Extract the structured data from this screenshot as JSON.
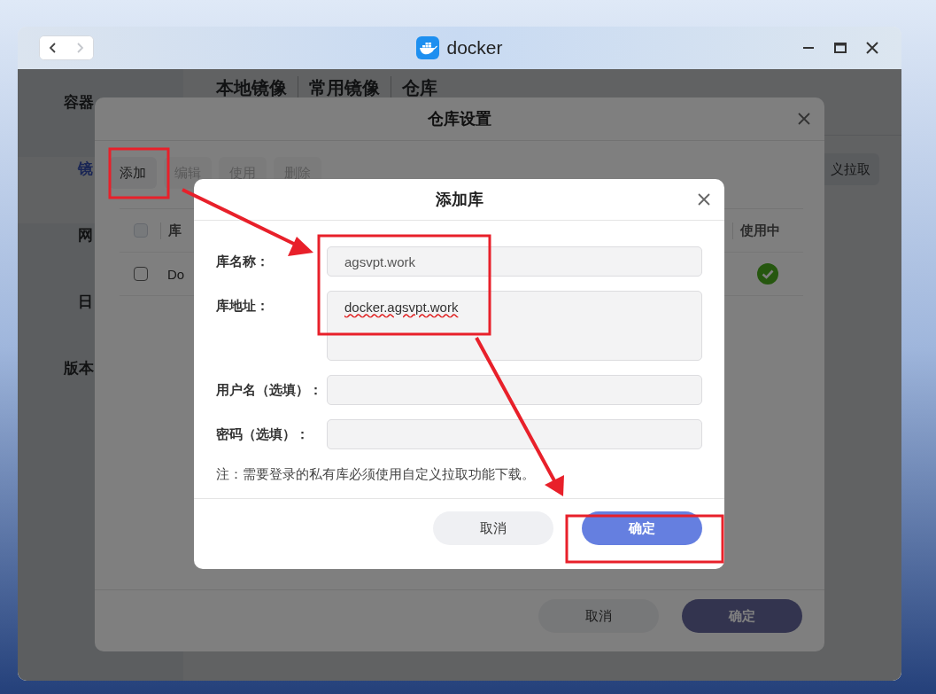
{
  "window": {
    "title": "docker"
  },
  "nav_buttons": [
    {
      "kind": "back",
      "disabled": false
    },
    {
      "kind": "forward",
      "disabled": true
    }
  ],
  "sidebar": {
    "items": [
      {
        "label": "容器",
        "selected": false,
        "kind": "group"
      },
      {
        "label": "镜",
        "selected": true,
        "kind": "item"
      },
      {
        "label": "网",
        "selected": false,
        "kind": "item"
      },
      {
        "label": "日",
        "selected": false,
        "kind": "item"
      },
      {
        "label": "版本",
        "selected": false,
        "kind": "group"
      }
    ]
  },
  "tabs": [
    "本地镜像",
    "常用镜像",
    "仓库"
  ],
  "custom_pull_button": "义拉取",
  "registry_dialog": {
    "title": "仓库设置",
    "toolbar": [
      {
        "label": "添加",
        "disabled": false
      },
      {
        "label": "编辑",
        "disabled": true
      },
      {
        "label": "使用",
        "disabled": true
      },
      {
        "label": "删除",
        "disabled": true
      }
    ],
    "table": {
      "header_checked": false,
      "columns": [
        "库",
        "使用中"
      ],
      "rows": [
        {
          "checked": false,
          "name": "Do",
          "in_use": true
        }
      ]
    },
    "buttons": [
      {
        "label": "取消",
        "kind": "secondary"
      },
      {
        "label": "确定",
        "kind": "primary"
      }
    ]
  },
  "add_dialog": {
    "title": "添加库",
    "fields": [
      {
        "label": "库名称：",
        "value": "agsvpt.work",
        "kind": "input"
      },
      {
        "label": "库地址：",
        "value": "docker.agsvpt.work",
        "kind": "textarea"
      },
      {
        "label": "用户名（选填）：",
        "kind": "input"
      },
      {
        "label": "密码（选填）：",
        "kind": "input"
      }
    ],
    "note": "注：需要登录的私有库必须使用自定义拉取功能下载。",
    "buttons": [
      {
        "label": "取消",
        "kind": "secondary"
      },
      {
        "label": "确定",
        "kind": "primary"
      }
    ]
  }
}
